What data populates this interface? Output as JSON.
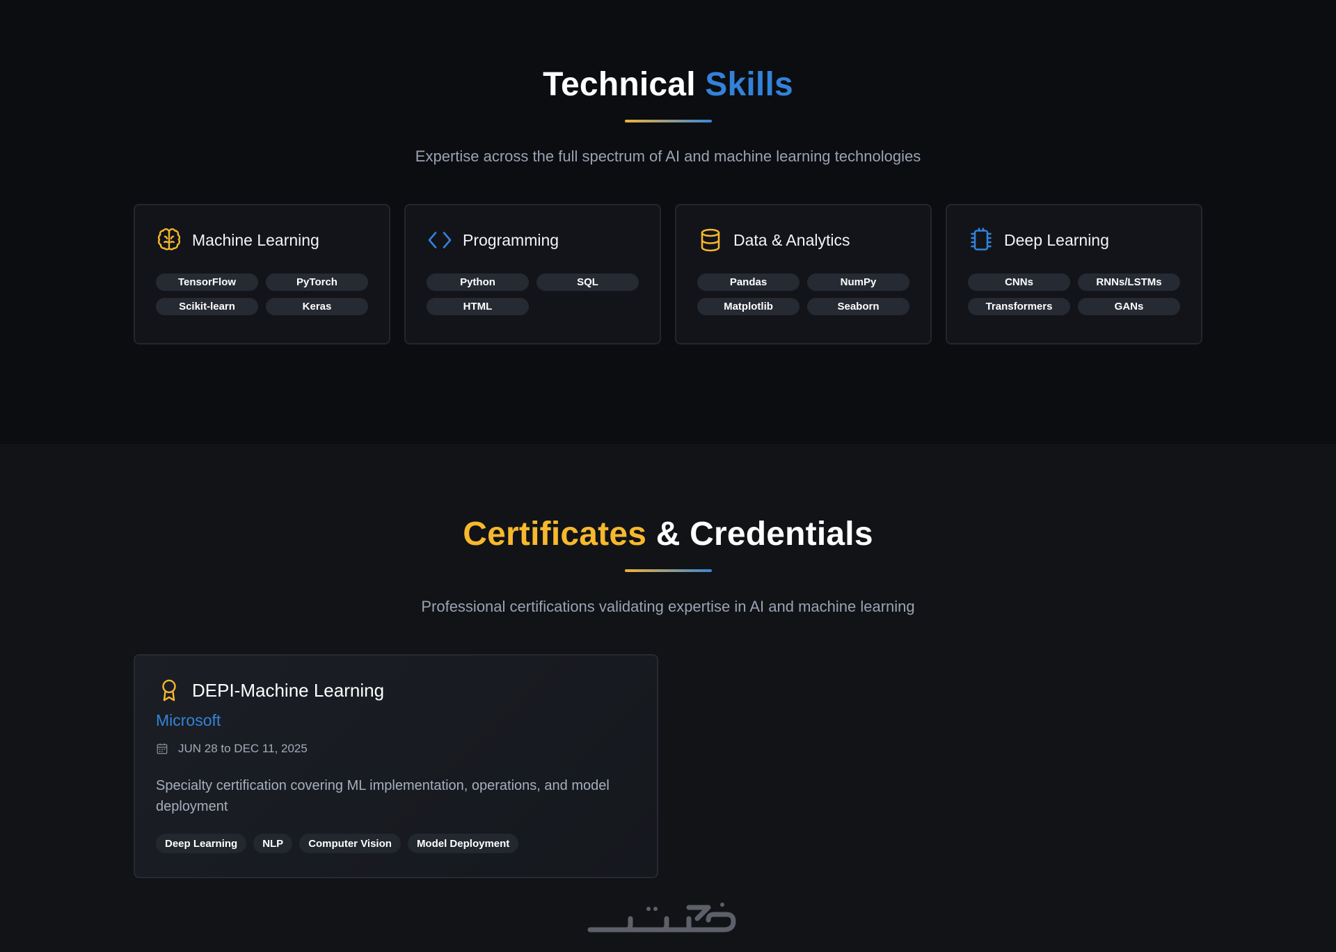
{
  "skills": {
    "title_main": "Technical",
    "title_accent": "Skills",
    "subtitle": "Expertise across the full spectrum of AI and machine learning technologies",
    "cards": [
      {
        "title": "Machine Learning",
        "icon": "brain-icon",
        "tags": [
          "TensorFlow",
          "PyTorch",
          "Scikit-learn",
          "Keras"
        ]
      },
      {
        "title": "Programming",
        "icon": "code-icon",
        "tags": [
          "Python",
          "SQL",
          "HTML"
        ]
      },
      {
        "title": "Data & Analytics",
        "icon": "database-icon",
        "tags": [
          "Pandas",
          "NumPy",
          "Matplotlib",
          "Seaborn"
        ]
      },
      {
        "title": "Deep Learning",
        "icon": "chip-icon",
        "tags": [
          "CNNs",
          "RNNs/LSTMs",
          "Transformers",
          "GANs"
        ]
      }
    ]
  },
  "certificates": {
    "title_accent": "Certificates",
    "title_main": "& Credentials",
    "subtitle": "Professional certifications validating expertise in AI and machine learning",
    "items": [
      {
        "icon": "award-icon",
        "title": "DEPI-Machine Learning",
        "issuer": "Microsoft",
        "date": "JUN 28 to DEC 11, 2025",
        "description": "Specialty certification covering ML implementation, operations, and model deployment",
        "tags": [
          "Deep Learning",
          "NLP",
          "Computer Vision",
          "Model Deployment"
        ]
      }
    ]
  },
  "watermark": {
    "text": "خمسات"
  },
  "colors": {
    "accent_blue": "#3382d9",
    "accent_gold": "#f6b82e",
    "background": "#0c0d11",
    "background_alt": "#111317",
    "tag_bg": "#262a32"
  }
}
